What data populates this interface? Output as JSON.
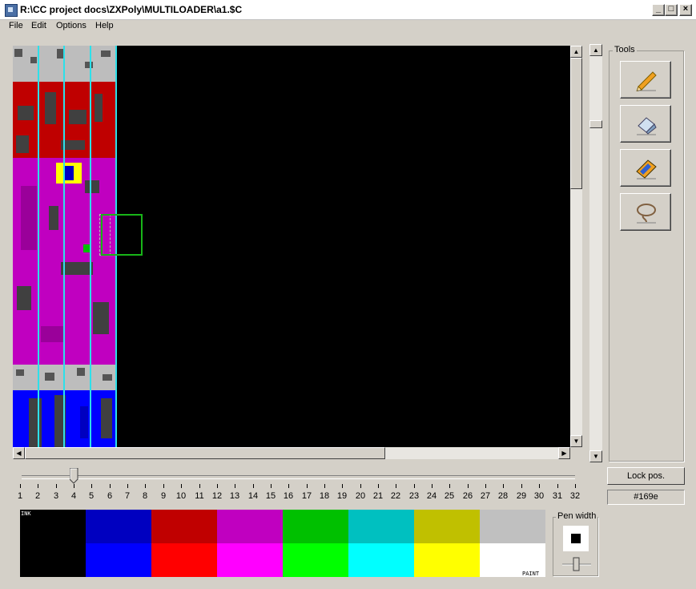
{
  "window": {
    "title": "R:\\CC project docs\\ZXPoly\\MULTILOADER\\a1.$C",
    "controls": {
      "minimize": "_",
      "maximize": "□",
      "close": "×"
    }
  },
  "menu": {
    "items": [
      "File",
      "Edit",
      "Options",
      "Help"
    ]
  },
  "tools": {
    "label": "Tools",
    "buttons": [
      {
        "name": "pencil",
        "icon": "pencil-icon"
      },
      {
        "name": "eraser",
        "icon": "eraser-icon"
      },
      {
        "name": "fill",
        "icon": "paint-bucket-icon"
      },
      {
        "name": "lasso",
        "icon": "lasso-icon"
      }
    ]
  },
  "zoom": {
    "labels": [
      "1",
      "2",
      "3",
      "4",
      "5",
      "6",
      "7",
      "8",
      "9",
      "10",
      "11",
      "12",
      "13",
      "14",
      "15",
      "16",
      "17",
      "18",
      "19",
      "20",
      "21",
      "22",
      "23",
      "24",
      "25",
      "26",
      "27",
      "28",
      "29",
      "30",
      "31",
      "32"
    ],
    "value": 4
  },
  "lock_button": "Lock pos.",
  "address": "#169e",
  "palette": {
    "ink_label": "INK",
    "paint_label": "PAINT",
    "normal": [
      "#000000",
      "#0000c0",
      "#c00000",
      "#c000c0",
      "#00c000",
      "#00c0c0",
      "#c0c000",
      "#c0c0c0"
    ],
    "bright": [
      "#000000",
      "#0000ff",
      "#ff0000",
      "#ff00ff",
      "#00ff00",
      "#00ffff",
      "#ffff00",
      "#ffffff"
    ]
  },
  "pen_width": {
    "label": "Pen width",
    "value": 1
  },
  "colors": {
    "guide": "#2de0ea",
    "selection": "#18b418",
    "viewport_bg": "#000000"
  }
}
